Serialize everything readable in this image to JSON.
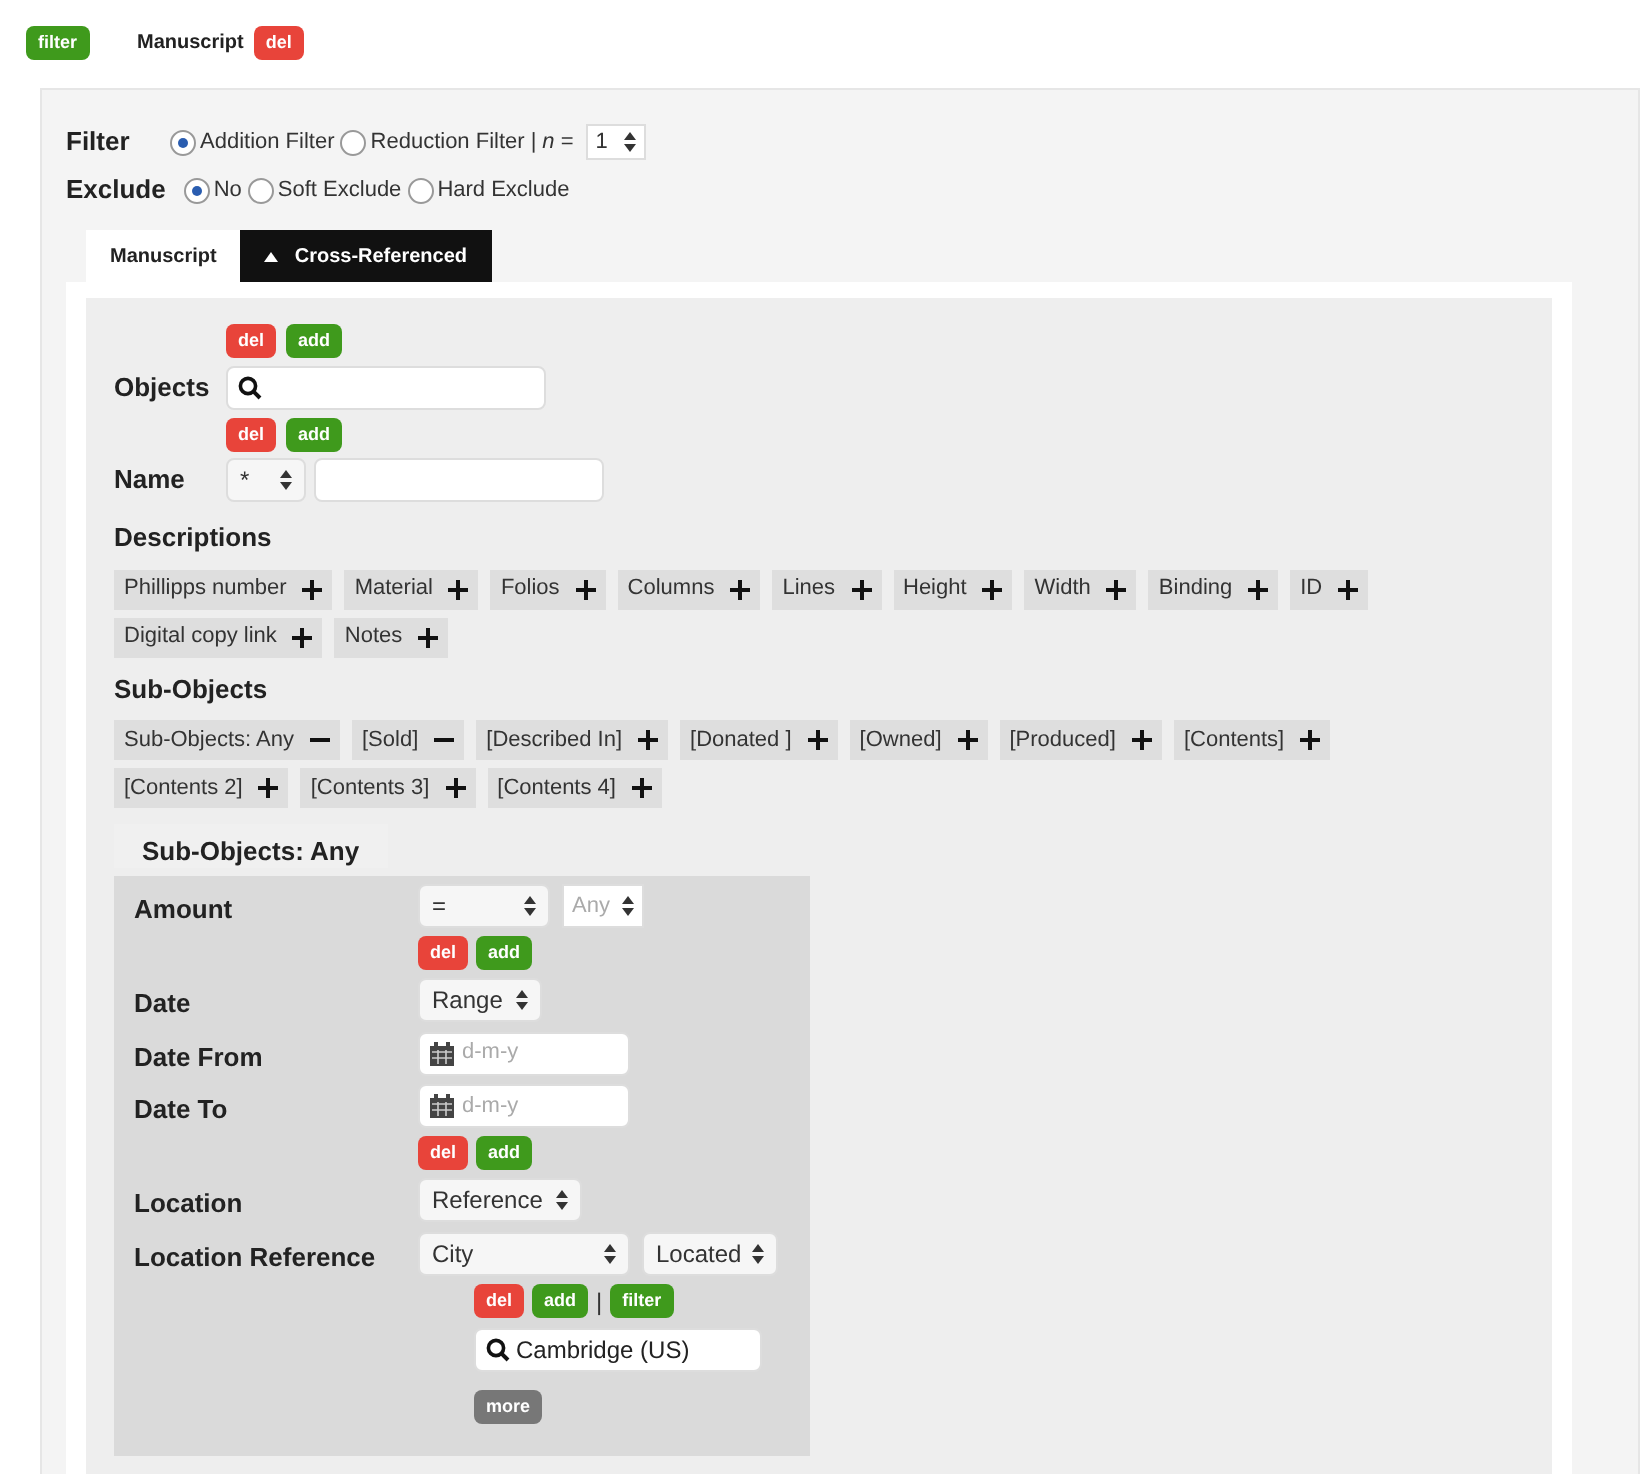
{
  "top": {
    "filter_button": {
      "label": "filter",
      "kind": "filter"
    },
    "tabs": [
      {
        "label": "Manuscript",
        "selected": true,
        "delete": {
          "label": "del",
          "kind": "del"
        }
      }
    ]
  },
  "filter": {
    "label": "Filter",
    "options": [
      {
        "label": "Addition Filter",
        "selected": true
      },
      {
        "label": "Reduction Filter",
        "selected": false
      }
    ],
    "separator": "|",
    "n_label": "*n* =",
    "n_value": "1"
  },
  "exclude": {
    "label": "Exclude",
    "options": [
      {
        "label": "No",
        "selected": true
      },
      {
        "label": "Soft Exclude",
        "selected": false
      },
      {
        "label": "Hard Exclude",
        "selected": false
      }
    ]
  },
  "inner_tabs": [
    {
      "label": "Manuscript",
      "selected": true
    },
    {
      "label": "Cross-Referenced",
      "selected": false
    }
  ],
  "objects": {
    "buttons": [
      {
        "label": "del",
        "kind": "del"
      },
      {
        "label": "add",
        "kind": "add"
      }
    ],
    "label": "Objects"
  },
  "name": {
    "buttons": [
      {
        "label": "del",
        "kind": "del"
      },
      {
        "label": "add",
        "kind": "add"
      }
    ],
    "label": "Name",
    "select": "*"
  },
  "descriptions": {
    "title": "Descriptions",
    "chips": [
      {
        "label": "Phillipps number",
        "removable": false
      },
      {
        "label": "Material",
        "removable": false
      },
      {
        "label": "Folios",
        "removable": false
      },
      {
        "label": "Columns",
        "removable": false
      },
      {
        "label": "Lines",
        "removable": false
      },
      {
        "label": "Height",
        "removable": false
      },
      {
        "label": "Width",
        "removable": false
      },
      {
        "label": "Binding",
        "removable": false
      },
      {
        "label": "ID",
        "removable": false
      },
      {
        "label": "Digital copy link",
        "removable": false
      },
      {
        "label": "Notes",
        "removable": false
      }
    ]
  },
  "sub_objects": {
    "title": "Sub-Objects",
    "chips": [
      {
        "label": "Sub-Objects: Any",
        "removable": true
      },
      {
        "label": "[Sold]",
        "removable": true
      },
      {
        "label": "[Described In]",
        "removable": false
      },
      {
        "label": "[Donated ]",
        "removable": false
      },
      {
        "label": "[Owned]",
        "removable": false
      },
      {
        "label": "[Produced]",
        "removable": false
      },
      {
        "label": "[Contents]",
        "removable": false
      },
      {
        "label": "[Contents 2]",
        "removable": false
      },
      {
        "label": "[Contents 3]",
        "removable": false
      },
      {
        "label": "[Contents 4]",
        "removable": false
      }
    ]
  },
  "group": {
    "legend": "Sub-Objects: Any",
    "amount": {
      "label": "Amount",
      "select": "=",
      "placeholder": "Any",
      "buttons": [
        {
          "label": "del",
          "kind": "del"
        },
        {
          "label": "add",
          "kind": "add"
        }
      ]
    },
    "date": {
      "label": "Date",
      "select": "Range"
    },
    "date_from": {
      "label": "Date From",
      "placeholder": "d-m-y"
    },
    "date_to": {
      "label": "Date To",
      "placeholder": "d-m-y",
      "buttons": [
        {
          "label": "del",
          "kind": "del"
        },
        {
          "label": "add",
          "kind": "add"
        }
      ]
    },
    "location": {
      "label": "Location",
      "select": "Reference"
    },
    "location_reference": {
      "label": "Location Reference",
      "selects": [
        "City",
        "Located"
      ],
      "buttons": [
        {
          "label": "del",
          "kind": "del"
        },
        {
          "label": "add",
          "kind": "add"
        },
        {
          "label": "filter",
          "kind": "filter"
        }
      ],
      "separator": "|",
      "search": "Cambridge (US)",
      "more": {
        "label": "more",
        "kind": "more"
      }
    }
  }
}
